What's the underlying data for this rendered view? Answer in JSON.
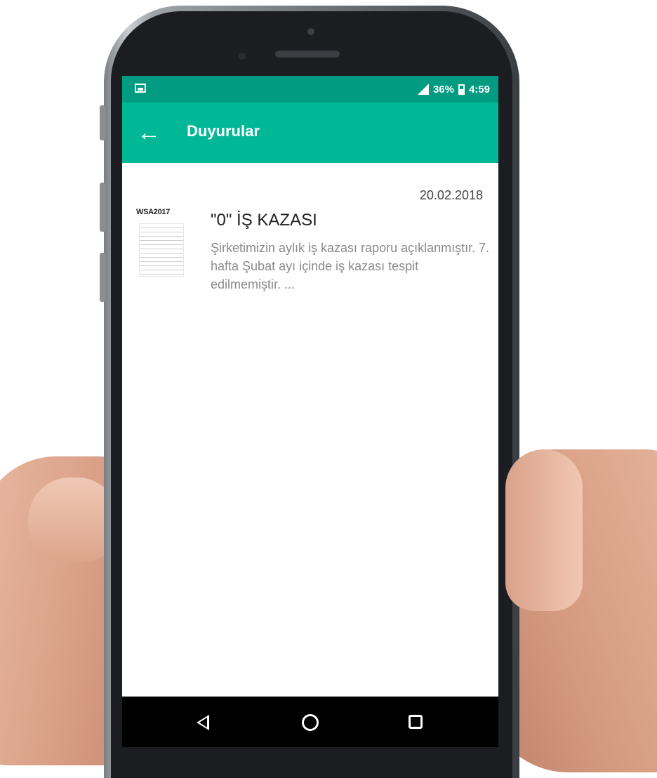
{
  "status_bar": {
    "battery_percent": "36%",
    "time": "4:59",
    "icons": [
      "image-notification-icon",
      "signal-icon",
      "battery-icon"
    ]
  },
  "app_bar": {
    "back_icon": "arrow-left-icon",
    "title": "Duyurular"
  },
  "announcements": [
    {
      "date": "20.02.2018",
      "thumbnail_label": "WSA2017",
      "title": "\"0\" İŞ KAZASI",
      "body": "Şirketimizin aylık iş kazası raporu açıklanmıştır. 7. hafta Şubat ayı içinde iş kazası tespit edilmemiştir. ..."
    }
  ],
  "nav_bar": {
    "icons": [
      "back-triangle-icon",
      "home-circle-icon",
      "recents-square-icon"
    ]
  },
  "colors": {
    "status_bar": "#009b81",
    "app_bar": "#00b796",
    "nav_bar": "#000000"
  }
}
